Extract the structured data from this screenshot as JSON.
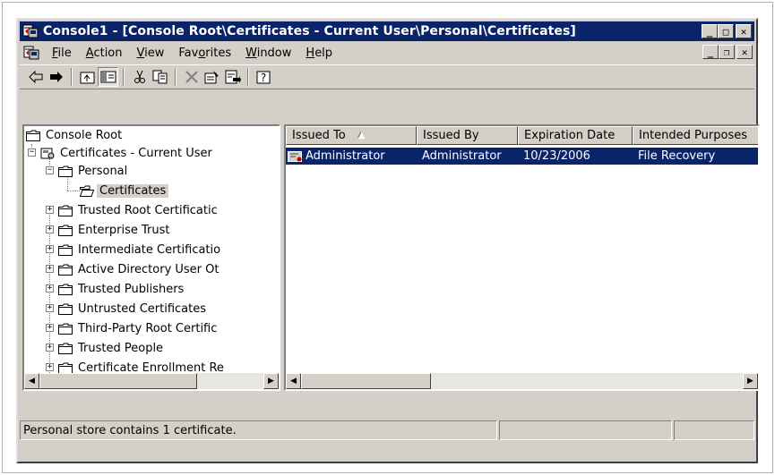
{
  "window": {
    "title": "Console1 - [Console Root\\Certificates - Current User\\Personal\\Certificates]",
    "app_icon": "mmc-console-icon"
  },
  "title_buttons": {
    "minimize": "_",
    "maximize": "□",
    "close": "✕"
  },
  "menu": {
    "items": [
      {
        "label": "File",
        "accel": "F"
      },
      {
        "label": "Action",
        "accel": "A"
      },
      {
        "label": "View",
        "accel": "V"
      },
      {
        "label": "Favorites",
        "accel": "o"
      },
      {
        "label": "Window",
        "accel": "W"
      },
      {
        "label": "Help",
        "accel": "H"
      }
    ]
  },
  "mdi_buttons": {
    "minimize": "_",
    "restore": "❐",
    "close": "✕"
  },
  "toolbar": {
    "buttons": [
      "back-icon",
      "forward-icon",
      "up-level-icon",
      "show-hide-tree-icon",
      "cut-icon",
      "copy-icon",
      "delete-icon",
      "properties-icon",
      "export-list-icon",
      "help-icon"
    ]
  },
  "tree": {
    "nodes": [
      {
        "label": "Console Root",
        "level": 0,
        "expander": ""
      },
      {
        "label": "Certificates - Current User",
        "level": 1,
        "expander": "−"
      },
      {
        "label": "Personal",
        "level": 2,
        "expander": "−"
      },
      {
        "label": "Certificates",
        "level": 3,
        "expander": "",
        "selected": true
      },
      {
        "label": "Trusted Root Certificatic",
        "level": 2,
        "expander": "+"
      },
      {
        "label": "Enterprise Trust",
        "level": 2,
        "expander": "+"
      },
      {
        "label": "Intermediate Certificatio",
        "level": 2,
        "expander": "+"
      },
      {
        "label": "Active Directory User Ot",
        "level": 2,
        "expander": "+"
      },
      {
        "label": "Trusted Publishers",
        "level": 2,
        "expander": "+"
      },
      {
        "label": "Untrusted Certificates",
        "level": 2,
        "expander": "+"
      },
      {
        "label": "Third-Party Root Certific",
        "level": 2,
        "expander": "+"
      },
      {
        "label": "Trusted People",
        "level": 2,
        "expander": "+"
      },
      {
        "label": "Certificate Enrollment Re",
        "level": 2,
        "expander": "+"
      }
    ]
  },
  "list": {
    "columns": [
      {
        "label": "Issued To",
        "sort": "▲"
      },
      {
        "label": "Issued By"
      },
      {
        "label": "Expiration Date"
      },
      {
        "label": "Intended Purposes"
      }
    ],
    "rows": [
      {
        "issued_to": "Administrator",
        "issued_by": "Administrator",
        "expiration": "10/23/2006",
        "purposes": "File Recovery",
        "selected": true
      }
    ]
  },
  "status": {
    "text": "Personal store contains 1 certificate."
  },
  "colors": {
    "titlebar": "#0a246a",
    "face": "#d4d0c8",
    "selection": "#0a246a"
  }
}
